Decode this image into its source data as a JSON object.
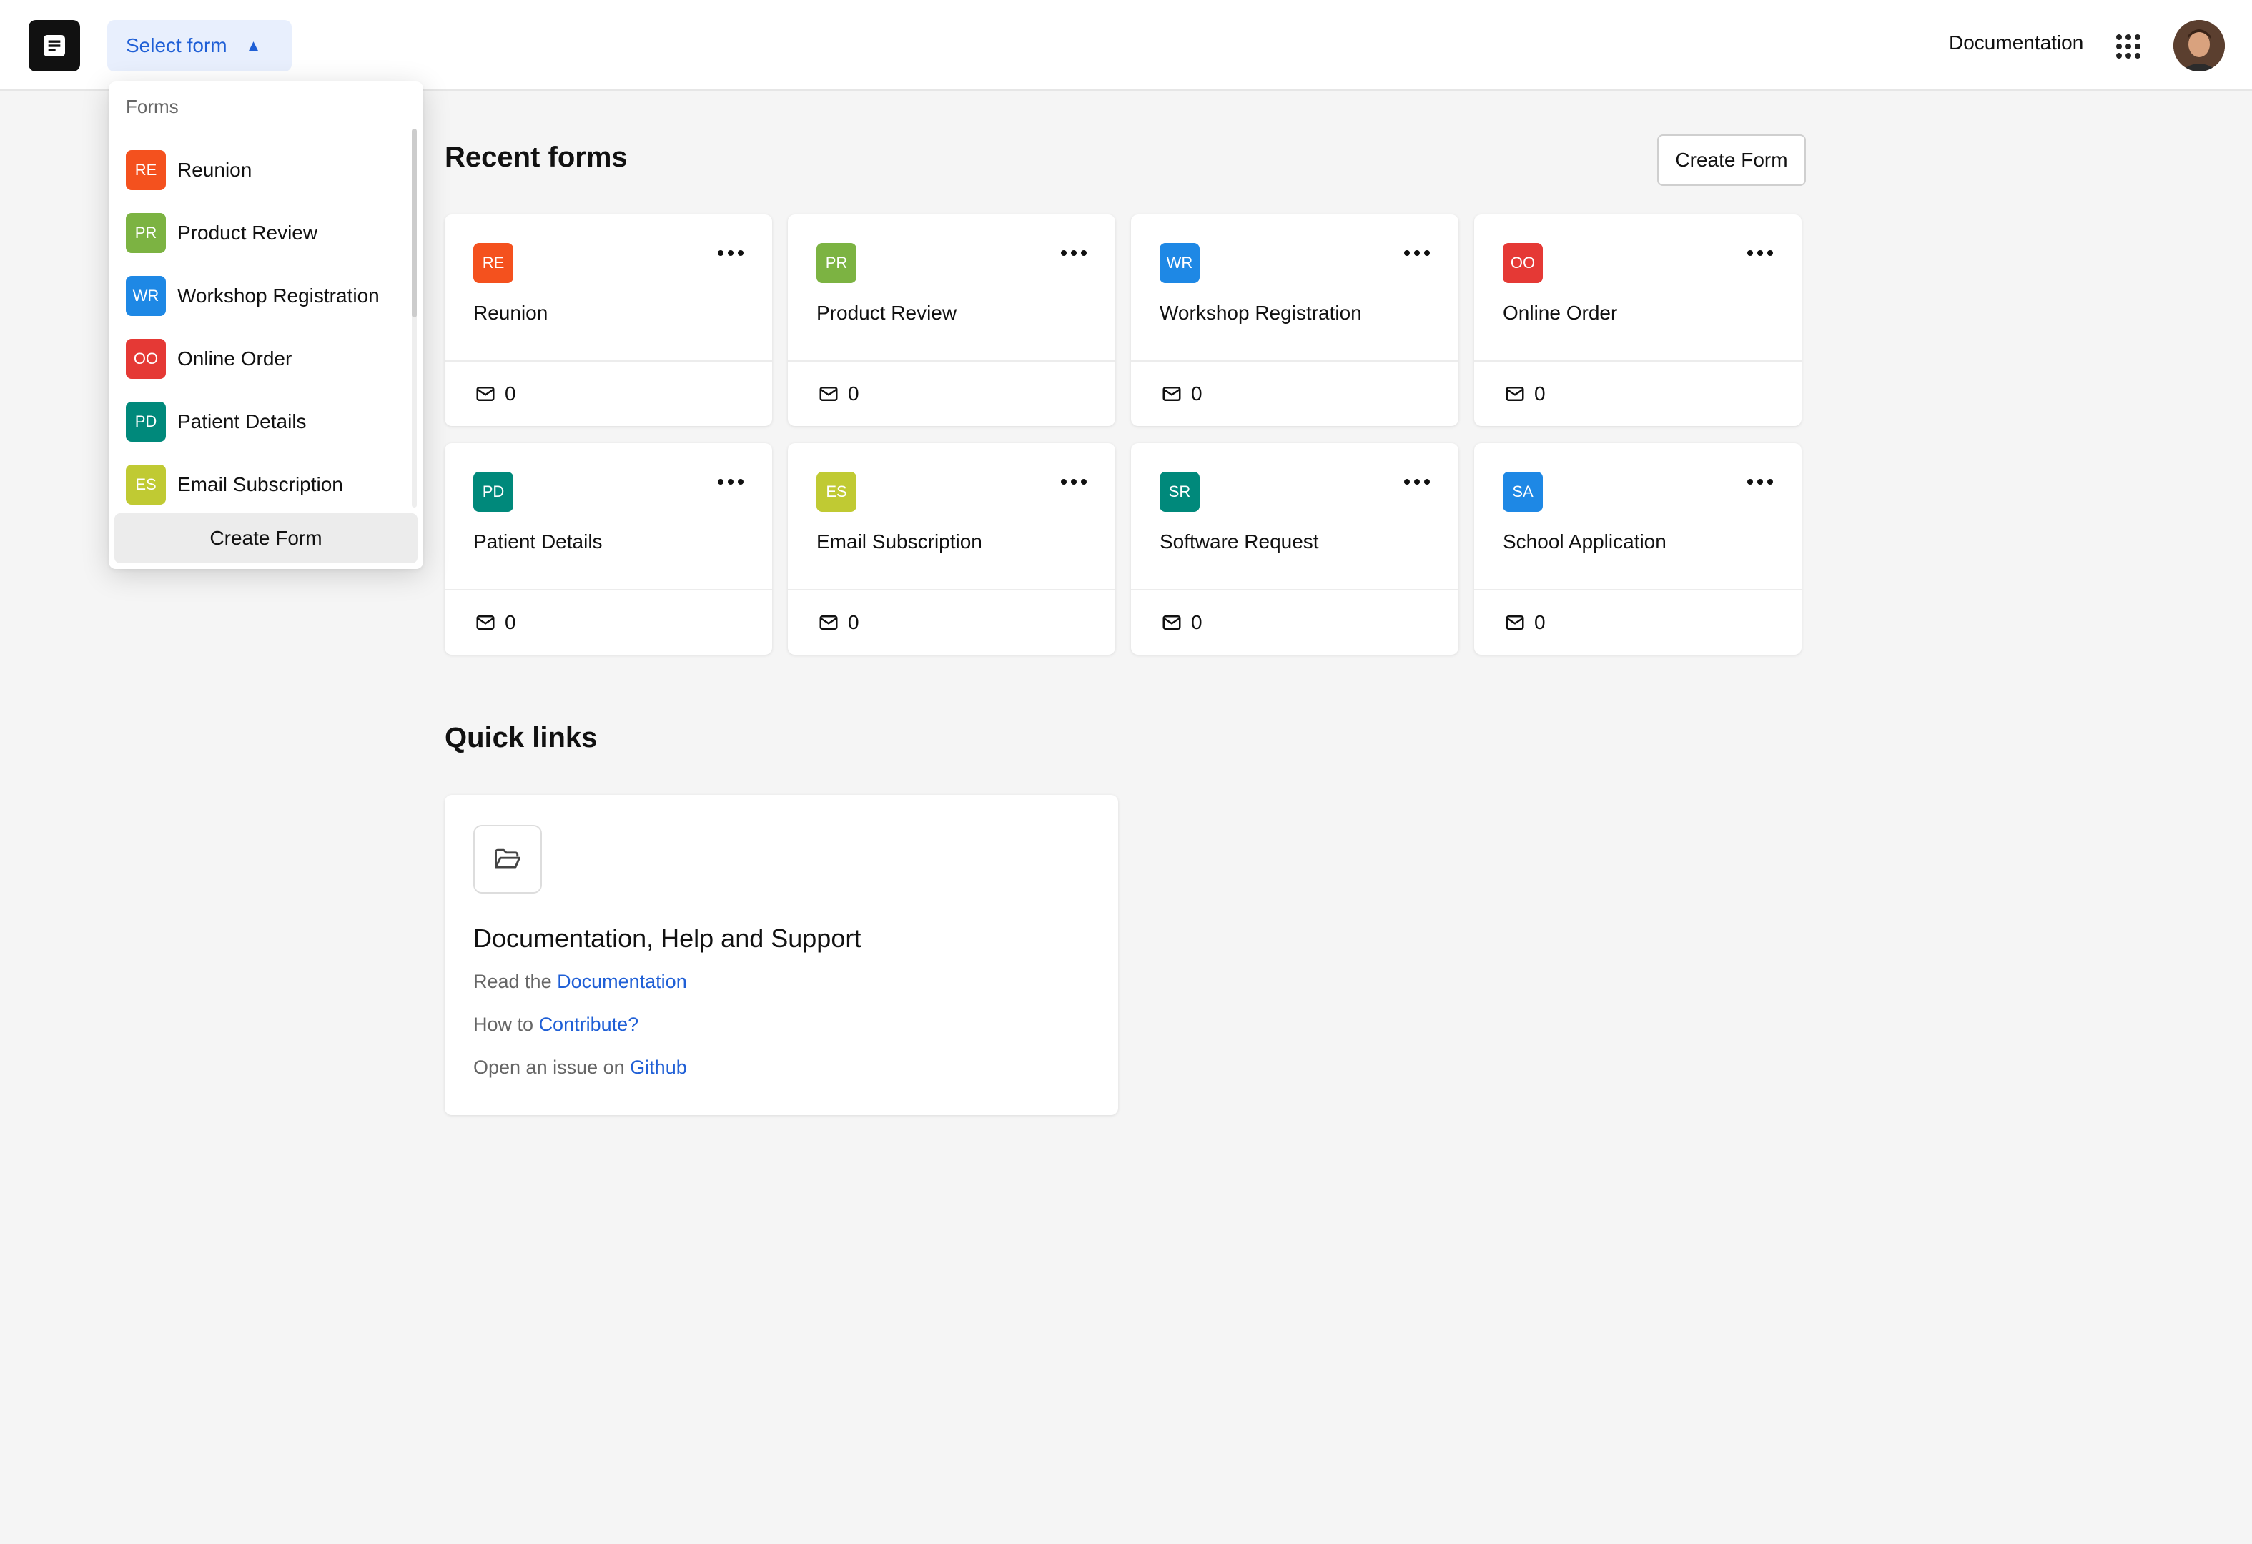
{
  "header": {
    "select_form_label": "Select form",
    "documentation_label": "Documentation",
    "logo_icon": "form-document-icon",
    "apps_icon": "apps-grid-icon",
    "caret_icon": "caret-up-icon"
  },
  "dropdown": {
    "heading": "Forms",
    "items": [
      {
        "initials": "RE",
        "label": "Reunion",
        "color": "#f4511e"
      },
      {
        "initials": "PR",
        "label": "Product Review",
        "color": "#7cb342"
      },
      {
        "initials": "WR",
        "label": "Workshop Registration",
        "color": "#1e88e5"
      },
      {
        "initials": "OO",
        "label": "Online Order",
        "color": "#e53935"
      },
      {
        "initials": "PD",
        "label": "Patient Details",
        "color": "#00897b"
      },
      {
        "initials": "ES",
        "label": "Email Subscription",
        "color": "#c0ca33"
      }
    ],
    "create_label": "Create Form"
  },
  "recent": {
    "title": "Recent forms",
    "create_label": "Create Form",
    "forms": [
      {
        "initials": "RE",
        "label": "Reunion",
        "color": "#f4511e",
        "count": "0"
      },
      {
        "initials": "PR",
        "label": "Product Review",
        "color": "#7cb342",
        "count": "0"
      },
      {
        "initials": "WR",
        "label": "Workshop Registration",
        "color": "#1e88e5",
        "count": "0"
      },
      {
        "initials": "OO",
        "label": "Online Order",
        "color": "#e53935",
        "count": "0"
      },
      {
        "initials": "PD",
        "label": "Patient Details",
        "color": "#00897b",
        "count": "0"
      },
      {
        "initials": "ES",
        "label": "Email Subscription",
        "color": "#c0ca33",
        "count": "0"
      },
      {
        "initials": "SR",
        "label": "Software Request",
        "color": "#00897b",
        "count": "0"
      },
      {
        "initials": "SA",
        "label": "School Application",
        "color": "#1e88e5",
        "count": "0"
      }
    ]
  },
  "quick_links": {
    "title": "Quick links",
    "card_title": "Documentation, Help and Support",
    "lines": [
      {
        "prefix": "Read the",
        "link": "Documentation"
      },
      {
        "prefix": "How to",
        "link": "Contribute?"
      },
      {
        "prefix": "Open an issue on",
        "link": "Github"
      }
    ]
  }
}
